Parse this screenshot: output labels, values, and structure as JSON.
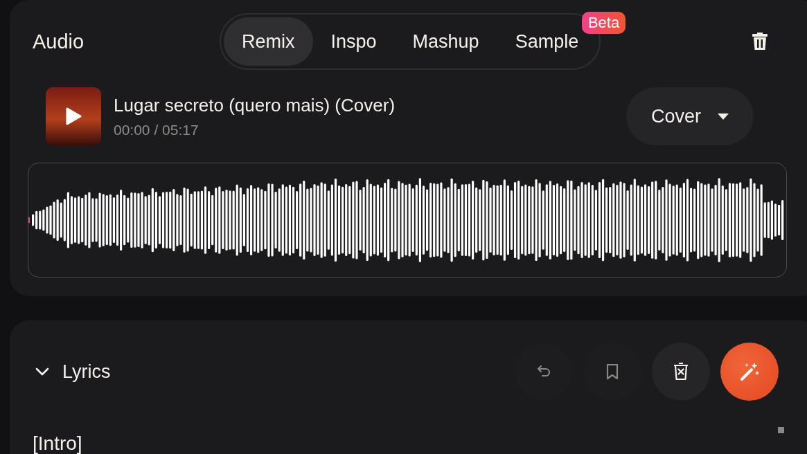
{
  "audio_panel": {
    "title": "Audio",
    "tabs": [
      {
        "label": "Remix",
        "selected": true
      },
      {
        "label": "Inspo",
        "selected": false
      },
      {
        "label": "Mashup",
        "selected": false
      },
      {
        "label": "Sample",
        "selected": false,
        "badge": "Beta"
      }
    ],
    "track": {
      "title": "Lugar secreto (quero mais) (Cover)",
      "time": "00:00 / 05:17"
    },
    "mode_dropdown": {
      "value": "Cover"
    }
  },
  "lyrics_panel": {
    "title": "Lyrics",
    "expanded": true,
    "actions": [
      {
        "kind": "undo",
        "disabled": true
      },
      {
        "kind": "bookmark",
        "disabled": true
      },
      {
        "kind": "clear",
        "disabled": false
      },
      {
        "kind": "generate",
        "disabled": false
      }
    ],
    "text": "[Intro]"
  }
}
